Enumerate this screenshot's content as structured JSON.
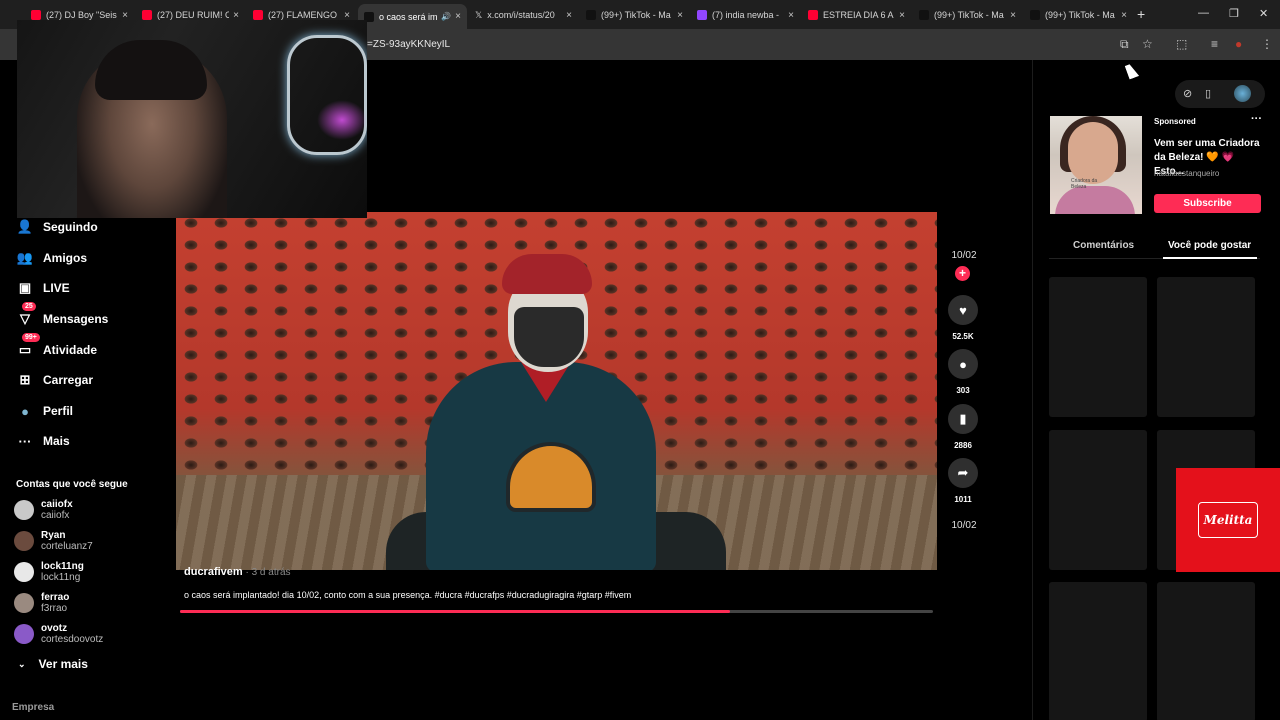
{
  "browser": {
    "tabs": [
      {
        "title": "(27) DJ Boy \"Seis I",
        "favicon_color": "#ff0033"
      },
      {
        "title": "(27) DEU RUIM! O",
        "favicon_color": "#ff0033"
      },
      {
        "title": "(27) FLAMENGO",
        "favicon_color": "#ff0033"
      },
      {
        "title": "o caos será im",
        "favicon_color": "#111111",
        "active": true,
        "audio_icon": "speaker-icon"
      },
      {
        "title": "x.com/i/status/20",
        "favicon_color": "#000000",
        "glyph": "𝕏"
      },
      {
        "title": "(99+) TikTok - Ma",
        "favicon_color": "#111111"
      },
      {
        "title": "(7) india newba -",
        "favicon_color": "#9146ff"
      },
      {
        "title": "ESTREIA DIA 6 A",
        "favicon_color": "#ff0033"
      },
      {
        "title": "(99+) TikTok - Ma",
        "favicon_color": "#111111"
      },
      {
        "title": "(99+) TikTok - Ma",
        "favicon_color": "#111111"
      }
    ],
    "close_glyph": "×",
    "new_tab_glyph": "+",
    "window_controls": [
      "—",
      "❐",
      "✕"
    ],
    "url": "=ZS-93ayKKNeyIL",
    "addr_icons": [
      "⧉",
      "☆",
      "⬚",
      "≡",
      "●",
      "⋮"
    ]
  },
  "webcam": {
    "description_icon": "webcam-overlay"
  },
  "nav": {
    "items": [
      {
        "label": "Seguindo",
        "icon": "👤",
        "icon_name": "following-icon"
      },
      {
        "label": "Amigos",
        "icon": "👥",
        "icon_name": "friends-icon"
      },
      {
        "label": "LIVE",
        "icon": "▣",
        "icon_name": "live-icon"
      },
      {
        "label": "Mensagens",
        "icon": "▽",
        "icon_name": "messages-icon",
        "badge": "25"
      },
      {
        "label": "Atividade",
        "icon": "▭",
        "icon_name": "activity-icon",
        "badge": "99+"
      },
      {
        "label": "Carregar",
        "icon": "⊞",
        "icon_name": "upload-icon"
      },
      {
        "label": "Perfil",
        "icon": "●",
        "icon_name": "profile-avatar-icon"
      },
      {
        "label": "Mais",
        "icon": "···",
        "icon_name": "more-icon"
      }
    ],
    "following_title": "Contas que você segue",
    "following": [
      {
        "name": "caiiofx",
        "handle": "caiiofx",
        "color": "#c9c9c9"
      },
      {
        "name": "Ryan",
        "handle": "corteluanz7",
        "color": "#6b4b3e"
      },
      {
        "name": "lock11ng",
        "handle": "lock11ng",
        "color": "#e8e8e8"
      },
      {
        "name": "ferrao",
        "handle": "f3rrao",
        "color": "#9a8a80"
      },
      {
        "name": "ovotz",
        "handle": "cortesdoovotz",
        "color": "#8a5ac8"
      }
    ],
    "see_more": "Ver mais",
    "see_more_icon": "⌄",
    "footer": "Empresa"
  },
  "video": {
    "username": "ducrafivem",
    "time_ago": " · 3 d atrás",
    "caption": "o caos será implantado! dia 10/02, conto com a sua presença. #ducra #ducrafps #ducradugiragira #gtarp #fivem",
    "progress": 0.73
  },
  "actions": {
    "date_top": "10/02",
    "plus_glyph": "+",
    "like": {
      "icon": "♥",
      "count": "52.5K"
    },
    "comment": {
      "icon": "●",
      "count": "303"
    },
    "save": {
      "icon": "▮",
      "count": "2886"
    },
    "share": {
      "icon": "➦",
      "count": "1011"
    },
    "date_bottom": "10/02"
  },
  "right_panel": {
    "pill_icons": [
      "⊘",
      "▯"
    ],
    "ad": {
      "sponsored": "Sponsored",
      "more": "···",
      "title": "Vem ser uma Criadora da Beleza! 🧡 💗 Esto...",
      "user": "nataliaestanqueiro",
      "cta": "Subscribe",
      "thumb_text": "Criadora da Beleza"
    },
    "tabs": [
      "Comentários",
      "Você pode gostar"
    ],
    "melitta": "Melitta"
  },
  "colors": {
    "accent": "#fe2c55",
    "melitta_red": "#e4111b"
  }
}
